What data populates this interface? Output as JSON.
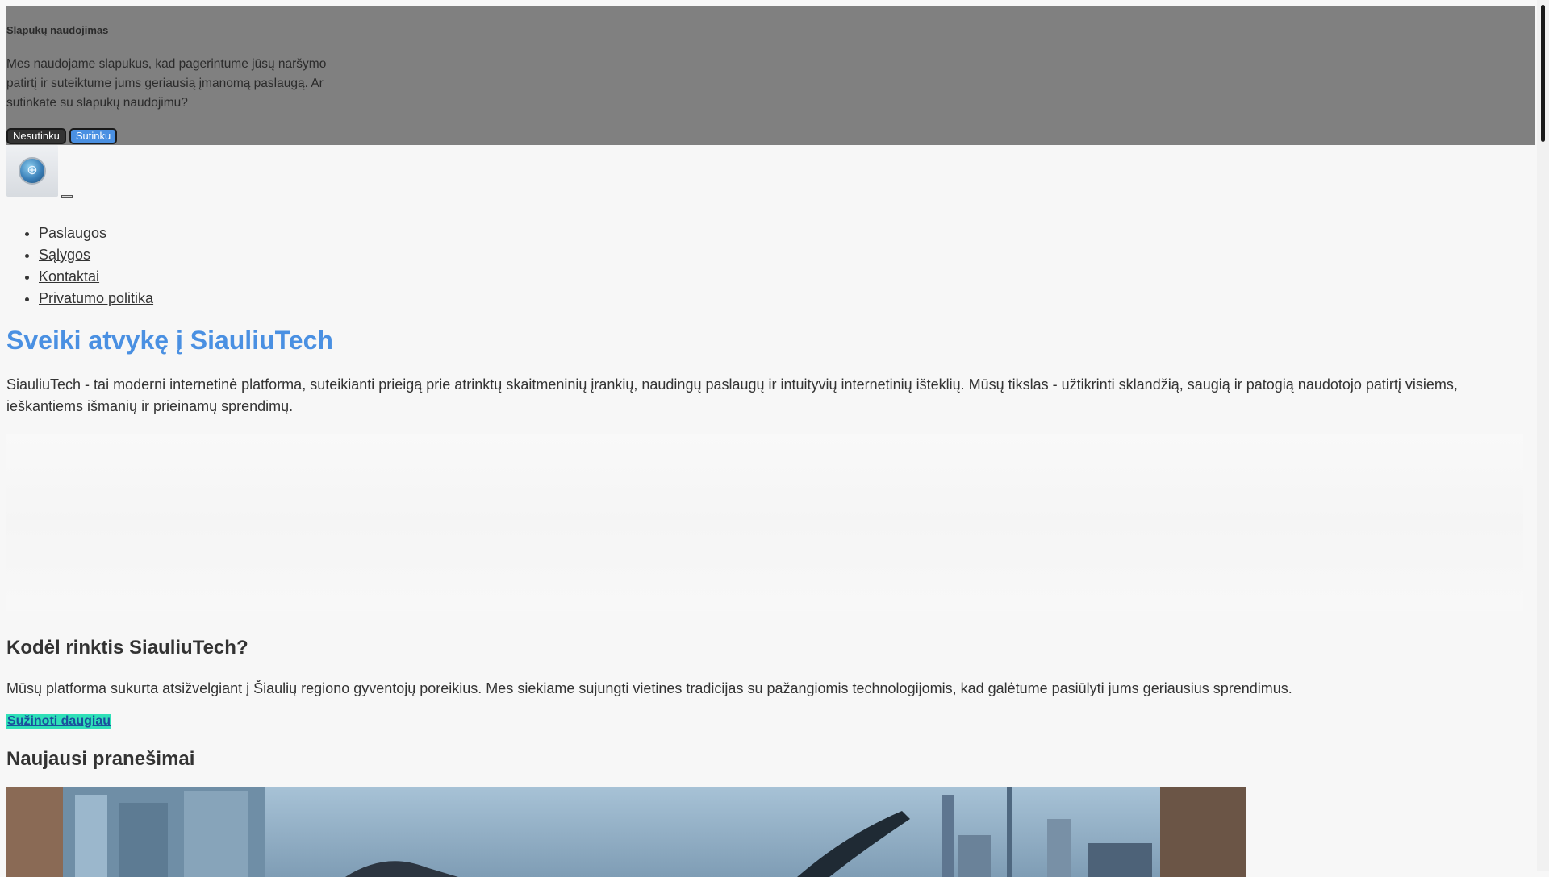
{
  "cookie_banner": {
    "title": "Slapukų naudojimas",
    "text": "Mes naudojame slapukus, kad pagerintume jūsų naršymo patirtį ir suteiktume jums geriausią įmanomą paslaugą. Ar sutinkate su slapukų naudojimu?",
    "decline_label": "Nesutinku",
    "accept_label": "Sutinku"
  },
  "nav": {
    "items": [
      {
        "label": "Paslaugos"
      },
      {
        "label": "Sąlygos"
      },
      {
        "label": "Kontaktai"
      },
      {
        "label": "Privatumo politika"
      }
    ]
  },
  "hero": {
    "title": "Sveiki atvykę į SiauliuTech",
    "text": "SiauliuTech - tai moderni internetinė platforma, suteikianti prieigą prie atrinktų skaitmeninių įrankių, naudingų paslaugų ir intuityvių internetinių išteklių. Mūsų tikslas - užtikrinti sklandžią, saugią ir patogią naudotojo patirtį visiems, ieškantiems išmanių ir prieinamų sprendimų."
  },
  "why": {
    "title": "Kodėl rinktis SiauliuTech?",
    "text": "Mūsų platforma sukurta atsižvelgiant į Šiaulių regiono gyventojų poreikius. Mes siekiame sujungti vietines tradicijas su pažangiomis technologijomis, kad galėtume pasiūlyti jums geriausius sprendimus.",
    "link_label": "Sužinoti daugiau"
  },
  "news": {
    "title": "Naujausi pranešimai"
  },
  "icons": {
    "logo": "globe-logo-icon",
    "menu_toggle": "menu-toggle-icon"
  },
  "colors": {
    "accent": "#4a90e2",
    "cookie_bg": "#808080",
    "link_highlight": "#2fe0b8"
  }
}
